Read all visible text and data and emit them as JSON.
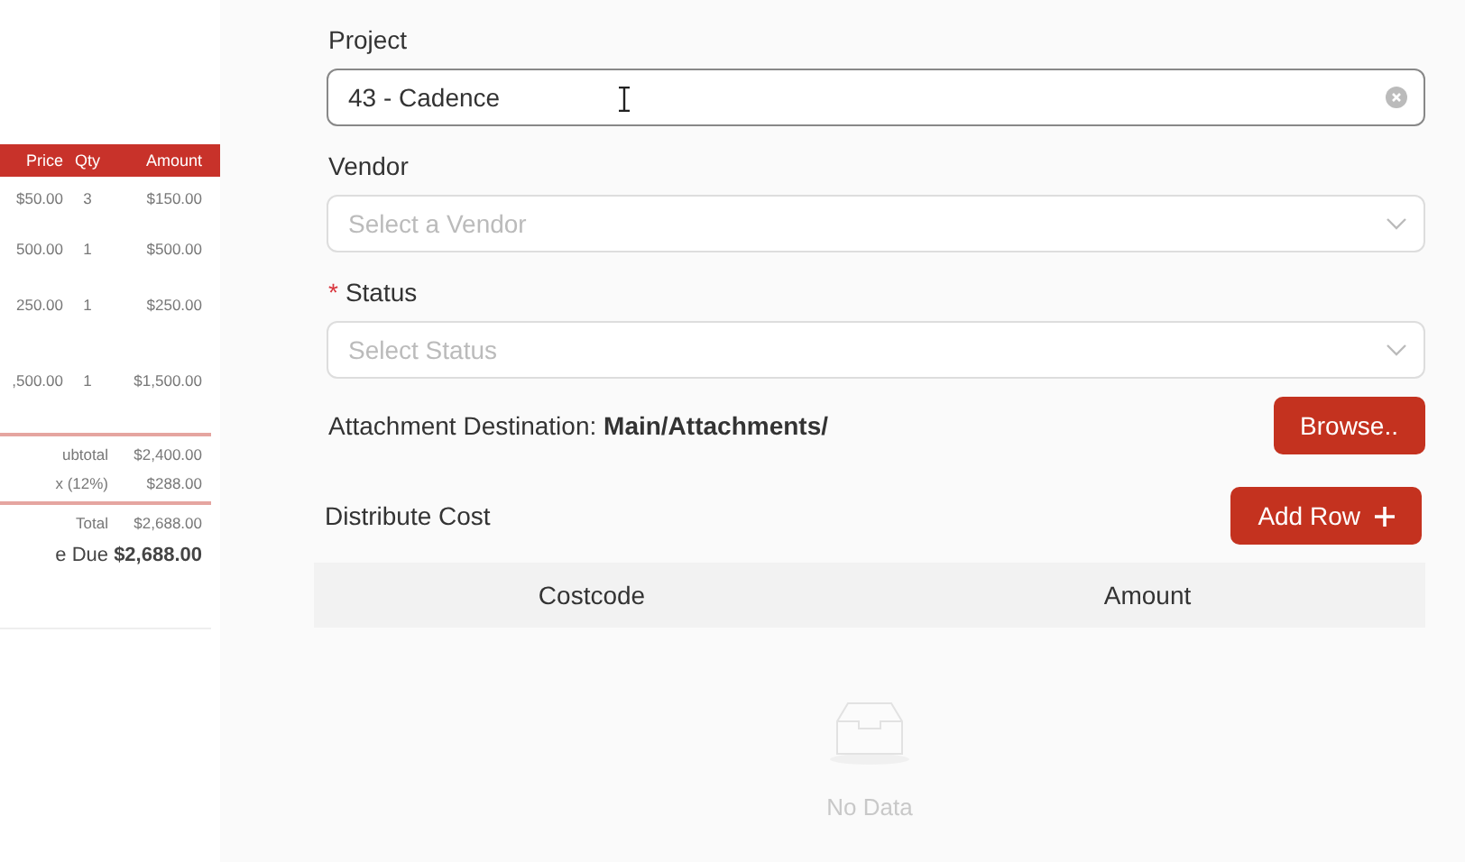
{
  "invoice_preview": {
    "columns": [
      "Price",
      "Qty",
      "Amount"
    ],
    "rows": [
      {
        "price": "$50.00",
        "qty": "3",
        "amount": "$150.00"
      },
      {
        "price": "500.00",
        "qty": "1",
        "amount": "$500.00"
      },
      {
        "price": "250.00",
        "qty": "1",
        "amount": "$250.00"
      },
      {
        "price": ",500.00",
        "qty": "1",
        "amount": "$1,500.00"
      }
    ],
    "totals": [
      {
        "kind": "sub",
        "label": "ubtotal",
        "value": "$2,400.00"
      },
      {
        "kind": "sub",
        "label": "x (12%)",
        "value": "$288.00"
      },
      {
        "kind": "total",
        "label": "Total",
        "value": "$2,688.00"
      },
      {
        "kind": "due",
        "label": "e Due",
        "value": "$2,688.00"
      }
    ]
  },
  "fields": [
    {
      "label": "Project",
      "kind": "text",
      "value": "43 - Cadence"
    },
    {
      "label": "Vendor",
      "kind": "select",
      "placeholder": "Select a Vendor"
    },
    {
      "label": "Status",
      "required_mark": "*",
      "kind": "select",
      "placeholder": "Select Status"
    }
  ],
  "attachment": {
    "text": "Attachment Destination: **Main/Attachments/**",
    "button": "Browse.."
  },
  "distribute": {
    "title": "Distribute Cost",
    "button": "Add Row",
    "table": {
      "columns": [
        "Costcode",
        "Amount"
      ],
      "empty_text": "No Data"
    }
  }
}
